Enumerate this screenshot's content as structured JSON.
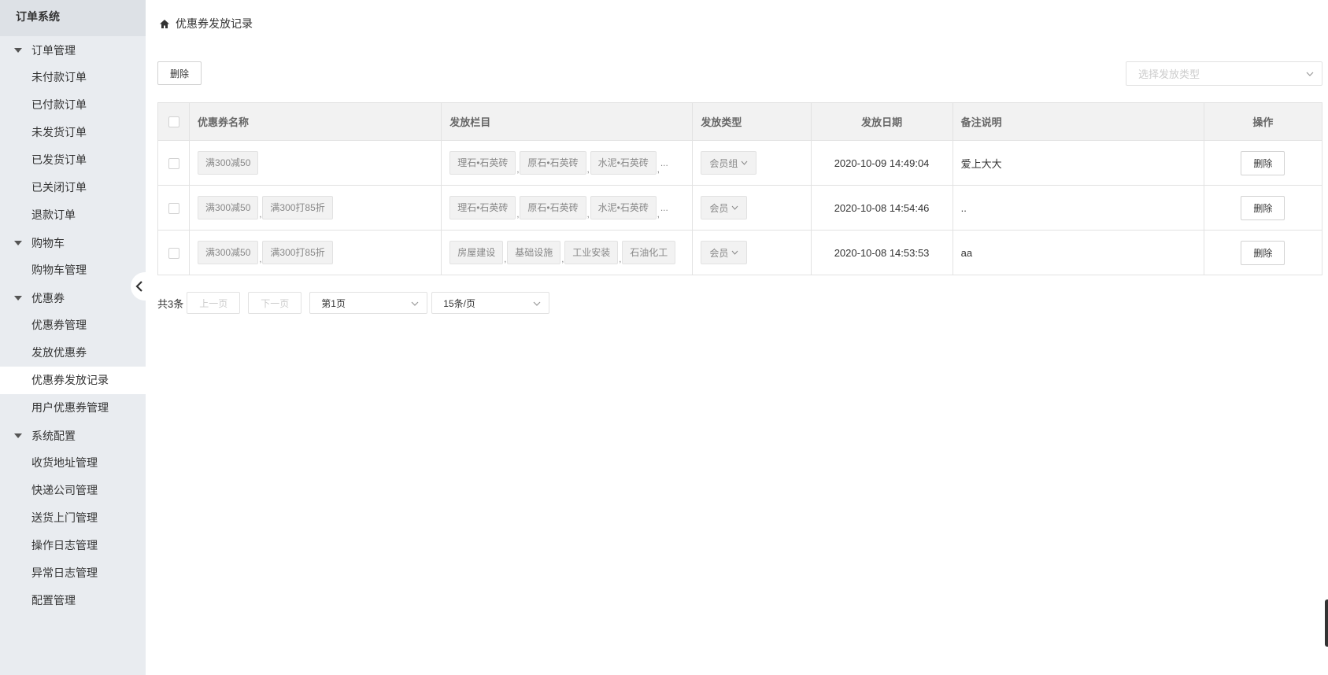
{
  "sidebar": {
    "title": "订单系统",
    "groups": [
      {
        "label": "订单管理",
        "items": [
          "未付款订单",
          "已付款订单",
          "未发货订单",
          "已发货订单",
          "已关闭订单",
          "退款订单"
        ]
      },
      {
        "label": "购物车",
        "items": [
          "购物车管理"
        ]
      },
      {
        "label": "优惠券",
        "items": [
          "优惠券管理",
          "发放优惠券",
          "优惠券发放记录",
          "用户优惠券管理"
        ]
      },
      {
        "label": "系统配置",
        "items": [
          "收货地址管理",
          "快递公司管理",
          "送货上门管理",
          "操作日志管理",
          "异常日志管理",
          "配置管理"
        ]
      }
    ],
    "active_item": "优惠券发放记录"
  },
  "breadcrumb": {
    "text": "优惠券发放记录"
  },
  "toolbar": {
    "delete_label": "删除",
    "type_select_placeholder": "选择发放类型"
  },
  "table": {
    "headers": [
      "优惠券名称",
      "发放栏目",
      "发放类型",
      "发放日期",
      "备注说明",
      "操作"
    ],
    "rows": [
      {
        "coupons": [
          "满300减50"
        ],
        "columns": [
          "理石•石英砖",
          "原石•石英砖",
          "水泥•石英砖"
        ],
        "columns_more": "...",
        "type": "会员组",
        "date": "2020-10-09 14:49:04",
        "note": "爱上大大",
        "action": "删除"
      },
      {
        "coupons": [
          "满300减50",
          "满300打85折"
        ],
        "columns": [
          "理石•石英砖",
          "原石•石英砖",
          "水泥•石英砖"
        ],
        "columns_more": "...",
        "type": "会员",
        "date": "2020-10-08 14:54:46",
        "note": "..",
        "action": "删除"
      },
      {
        "coupons": [
          "满300减50",
          "满300打85折"
        ],
        "columns": [
          "房屋建设",
          "基础设施",
          "工业安装",
          "石油化工"
        ],
        "columns_more": "",
        "type": "会员",
        "date": "2020-10-08 14:53:53",
        "note": "aa",
        "action": "删除"
      }
    ]
  },
  "pager": {
    "total": "共3条",
    "prev": "上一页",
    "next": "下一页",
    "page": "第1页",
    "page_size": "15条/页"
  },
  "icons": {
    "home": "home-icon",
    "collapse": "chevron-left-icon",
    "dropdown": "chevron-down-icon"
  }
}
